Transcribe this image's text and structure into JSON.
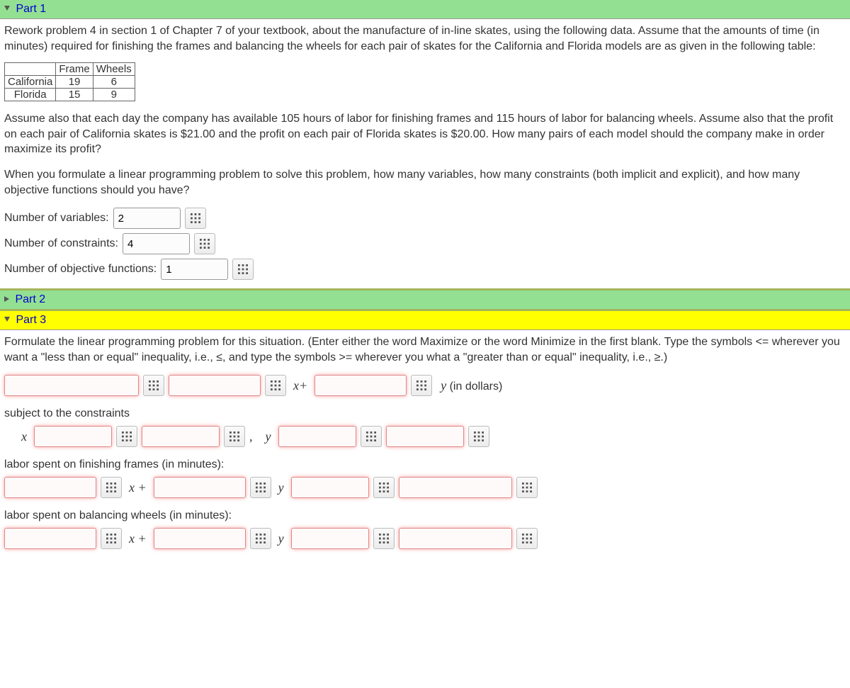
{
  "part1": {
    "title": "Part 1",
    "intro": "Rework problem 4 in section 1 of Chapter 7 of your textbook, about the manufacture of in-line skates, using the following data. Assume that the amounts of time (in minutes) required for finishing the frames and balancing the wheels for each pair of skates for the California and Florida models are as given in the following table:",
    "table": {
      "h1": "",
      "h2": "Frame",
      "h3": "Wheels",
      "r1c1": "California",
      "r1c2": "19",
      "r1c3": "6",
      "r2c1": "Florida",
      "r2c2": "15",
      "r2c3": "9"
    },
    "para2": "Assume also that each day the company has available 105 hours of labor for finishing frames and 115 hours of labor for balancing wheels. Assume also that the profit on each pair of California skates is $21.00 and the profit on each pair of Florida skates is $20.00. How many pairs of each model should the company make in order maximize its profit?",
    "para3": "When you formulate a linear programming problem to solve this problem, how many variables, how many constraints (both implicit and explicit), and how many objective functions should you have?",
    "vars_label": "Number of variables:",
    "vars_value": "2",
    "cons_label": "Number of constraints:",
    "cons_value": "4",
    "obj_label": "Number of objective functions:",
    "obj_value": "1"
  },
  "part2": {
    "title": "Part 2"
  },
  "part3": {
    "title": "Part 3",
    "intro": "Formulate the linear programming problem for this situation. (Enter either the word Maximize or the word Minimize in the first blank. Type the symbols <= wherever you want a \"less than or equal\" inequality, i.e., ≤, and type the symbols >= wherever you what a \"greater than or equal\" inequality, i.e., ≥.)",
    "xplus": "x+",
    "x_plus_space": "x +",
    "y_in_dollars": "y (in dollars)",
    "subject": "subject to the constraints",
    "x": "x",
    "y": "y",
    "comma": ",",
    "frames_label": "labor spent on finishing frames (in minutes):",
    "wheels_label": "labor spent on balancing wheels (in minutes):"
  }
}
